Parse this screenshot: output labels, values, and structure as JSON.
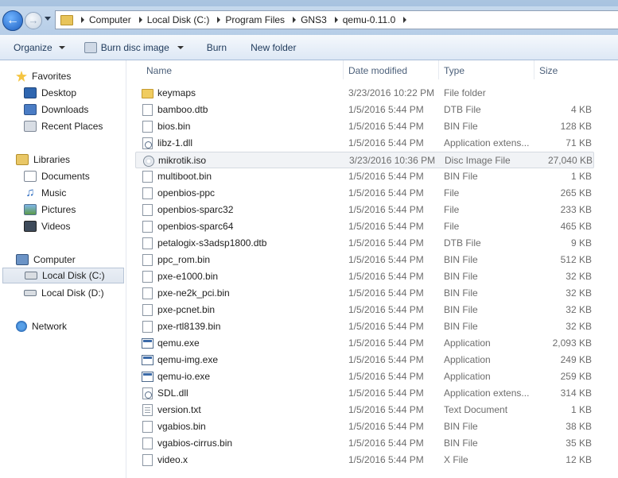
{
  "address": {
    "crumbs": [
      "Computer",
      "Local Disk (C:)",
      "Program Files",
      "GNS3",
      "qemu-0.11.0"
    ]
  },
  "toolbar": {
    "organize": "Organize",
    "burn_disc_image": "Burn disc image",
    "burn": "Burn",
    "new_folder": "New folder"
  },
  "nav": {
    "favorites": "Favorites",
    "desktop": "Desktop",
    "downloads": "Downloads",
    "recent_places": "Recent Places",
    "libraries": "Libraries",
    "documents": "Documents",
    "music": "Music",
    "pictures": "Pictures",
    "videos": "Videos",
    "computer": "Computer",
    "local_disk_c": "Local Disk (C:)",
    "local_disk_d": "Local Disk (D:)",
    "network": "Network"
  },
  "columns": {
    "name": "Name",
    "date_modified": "Date modified",
    "type": "Type",
    "size": "Size"
  },
  "files": [
    {
      "name": "keymaps",
      "date": "3/23/2016 10:22 PM",
      "type": "File folder",
      "size": "",
      "icon": "folder"
    },
    {
      "name": "bamboo.dtb",
      "date": "1/5/2016 5:44 PM",
      "type": "DTB File",
      "size": "4 KB",
      "icon": "doc"
    },
    {
      "name": "bios.bin",
      "date": "1/5/2016 5:44 PM",
      "type": "BIN File",
      "size": "128 KB",
      "icon": "doc"
    },
    {
      "name": "libz-1.dll",
      "date": "1/5/2016 5:44 PM",
      "type": "Application extens...",
      "size": "71 KB",
      "icon": "dll"
    },
    {
      "name": "mikrotik.iso",
      "date": "3/23/2016 10:36 PM",
      "type": "Disc Image File",
      "size": "27,040 KB",
      "icon": "disc"
    },
    {
      "name": "multiboot.bin",
      "date": "1/5/2016 5:44 PM",
      "type": "BIN File",
      "size": "1 KB",
      "icon": "doc"
    },
    {
      "name": "openbios-ppc",
      "date": "1/5/2016 5:44 PM",
      "type": "File",
      "size": "265 KB",
      "icon": "doc"
    },
    {
      "name": "openbios-sparc32",
      "date": "1/5/2016 5:44 PM",
      "type": "File",
      "size": "233 KB",
      "icon": "doc"
    },
    {
      "name": "openbios-sparc64",
      "date": "1/5/2016 5:44 PM",
      "type": "File",
      "size": "465 KB",
      "icon": "doc"
    },
    {
      "name": "petalogix-s3adsp1800.dtb",
      "date": "1/5/2016 5:44 PM",
      "type": "DTB File",
      "size": "9 KB",
      "icon": "doc"
    },
    {
      "name": "ppc_rom.bin",
      "date": "1/5/2016 5:44 PM",
      "type": "BIN File",
      "size": "512 KB",
      "icon": "doc"
    },
    {
      "name": "pxe-e1000.bin",
      "date": "1/5/2016 5:44 PM",
      "type": "BIN File",
      "size": "32 KB",
      "icon": "doc"
    },
    {
      "name": "pxe-ne2k_pci.bin",
      "date": "1/5/2016 5:44 PM",
      "type": "BIN File",
      "size": "32 KB",
      "icon": "doc"
    },
    {
      "name": "pxe-pcnet.bin",
      "date": "1/5/2016 5:44 PM",
      "type": "BIN File",
      "size": "32 KB",
      "icon": "doc"
    },
    {
      "name": "pxe-rtl8139.bin",
      "date": "1/5/2016 5:44 PM",
      "type": "BIN File",
      "size": "32 KB",
      "icon": "doc"
    },
    {
      "name": "qemu.exe",
      "date": "1/5/2016 5:44 PM",
      "type": "Application",
      "size": "2,093 KB",
      "icon": "exe"
    },
    {
      "name": "qemu-img.exe",
      "date": "1/5/2016 5:44 PM",
      "type": "Application",
      "size": "249 KB",
      "icon": "exe"
    },
    {
      "name": "qemu-io.exe",
      "date": "1/5/2016 5:44 PM",
      "type": "Application",
      "size": "259 KB",
      "icon": "exe"
    },
    {
      "name": "SDL.dll",
      "date": "1/5/2016 5:44 PM",
      "type": "Application extens...",
      "size": "314 KB",
      "icon": "dll"
    },
    {
      "name": "version.txt",
      "date": "1/5/2016 5:44 PM",
      "type": "Text Document",
      "size": "1 KB",
      "icon": "txt"
    },
    {
      "name": "vgabios.bin",
      "date": "1/5/2016 5:44 PM",
      "type": "BIN File",
      "size": "38 KB",
      "icon": "doc"
    },
    {
      "name": "vgabios-cirrus.bin",
      "date": "1/5/2016 5:44 PM",
      "type": "BIN File",
      "size": "35 KB",
      "icon": "doc"
    },
    {
      "name": "video.x",
      "date": "1/5/2016 5:44 PM",
      "type": "X File",
      "size": "12 KB",
      "icon": "doc"
    }
  ],
  "selected_file": "mikrotik.iso"
}
